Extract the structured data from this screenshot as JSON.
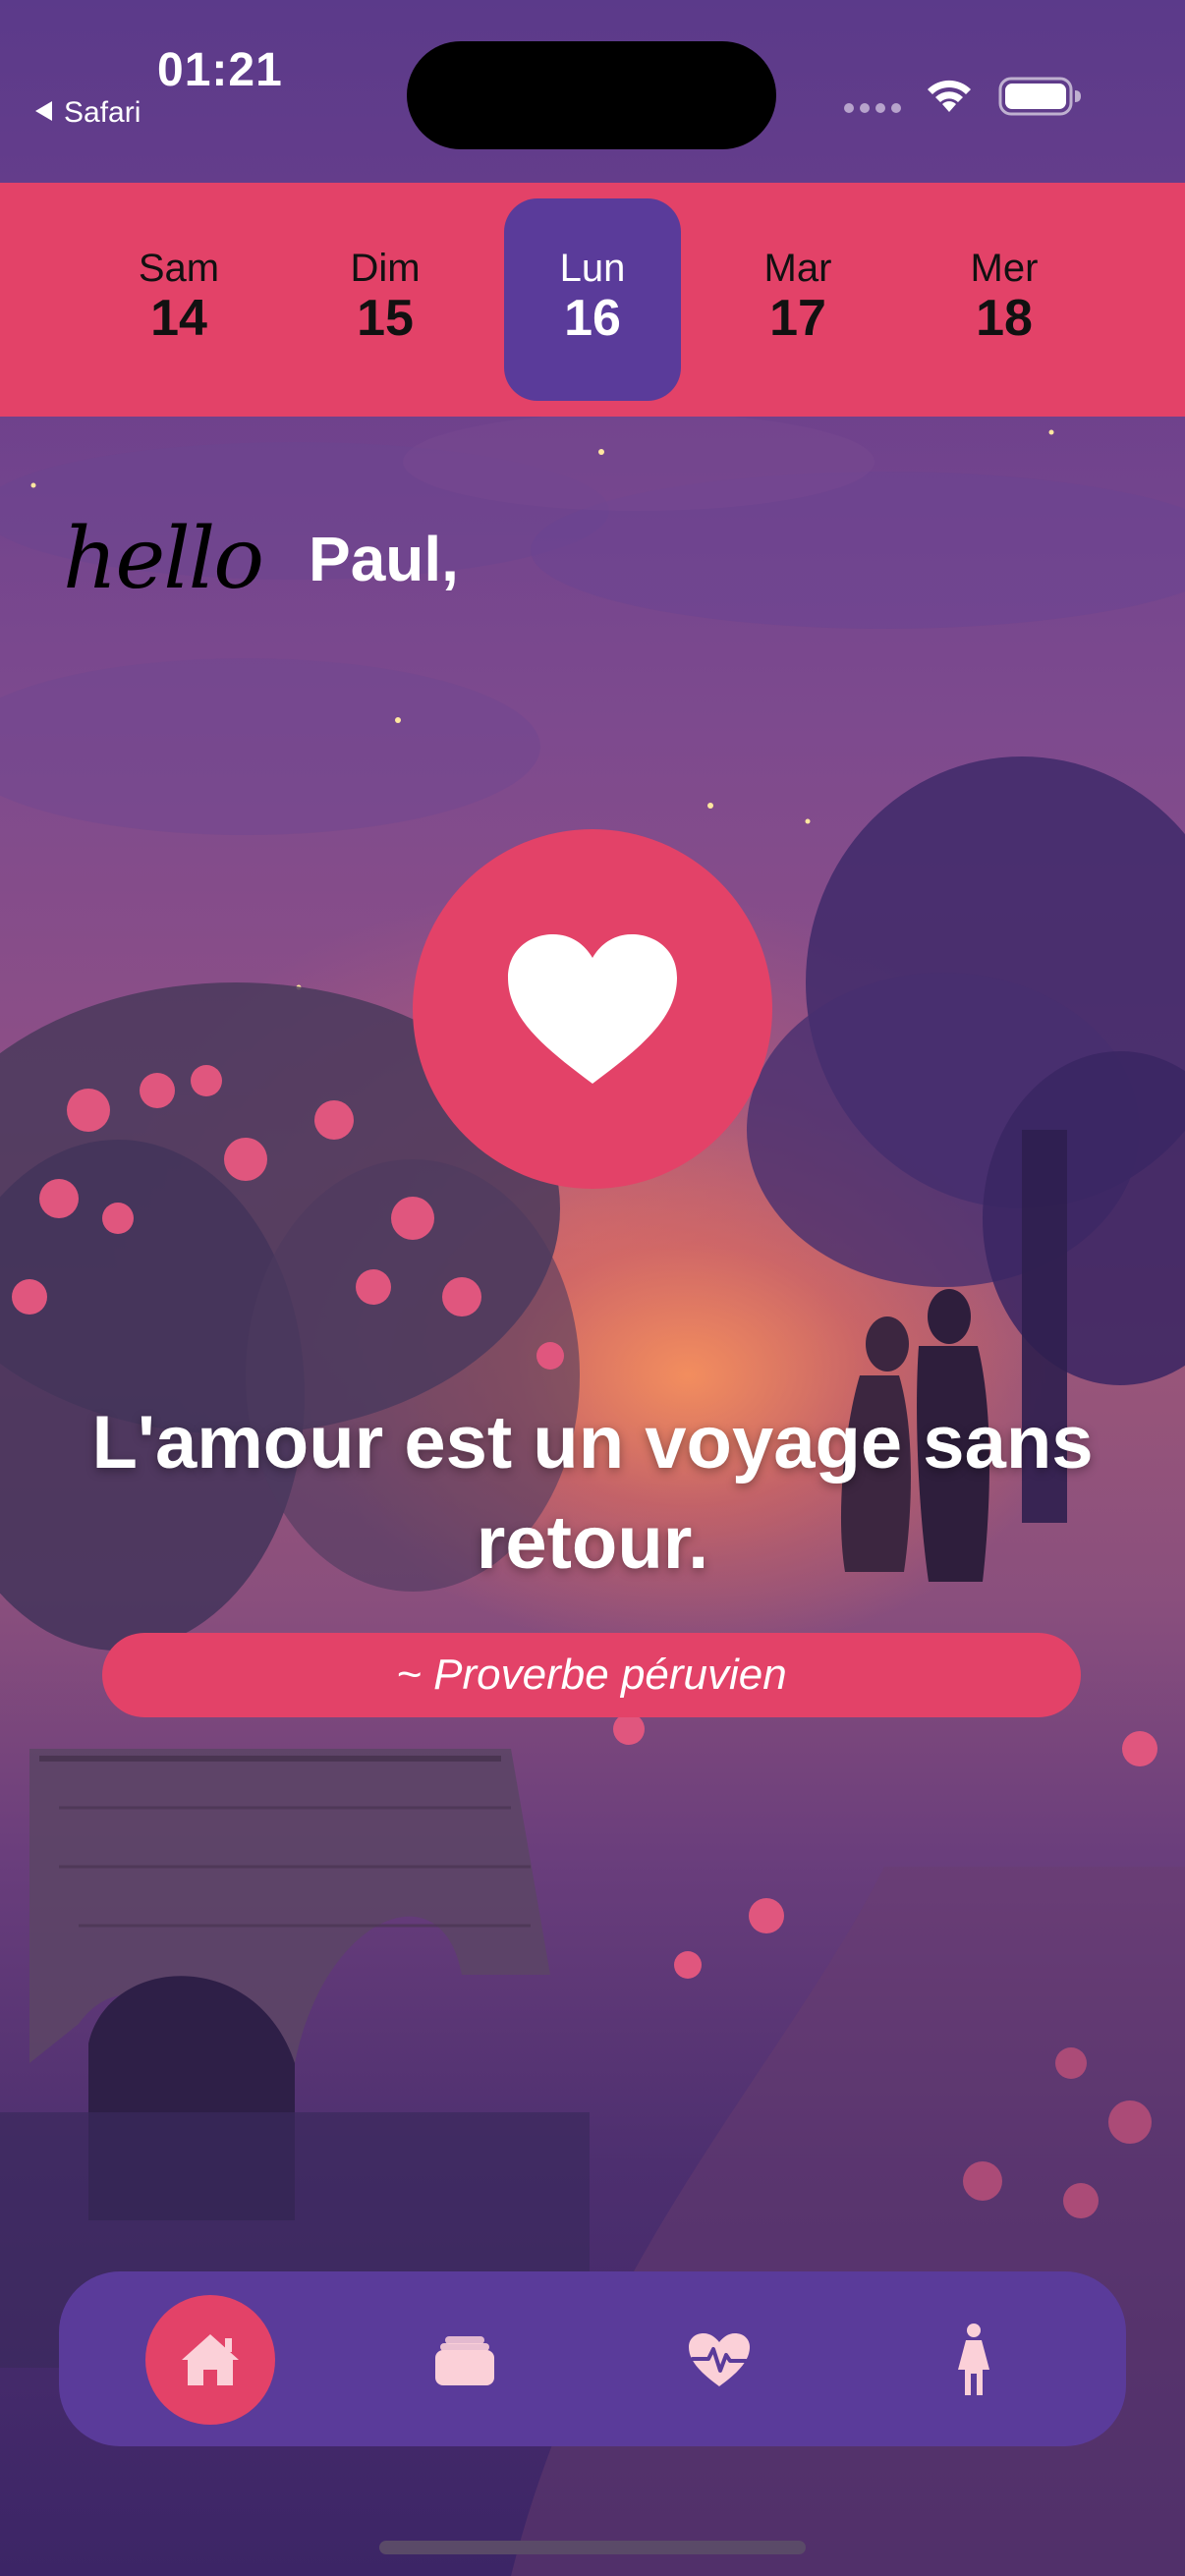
{
  "status_bar": {
    "time": "01:21",
    "back_app": "Safari"
  },
  "date_strip": {
    "days": [
      {
        "name": "Sam",
        "num": "14",
        "active": false
      },
      {
        "name": "Dim",
        "num": "15",
        "active": false
      },
      {
        "name": "Lun",
        "num": "16",
        "active": true
      },
      {
        "name": "Mar",
        "num": "17",
        "active": false
      },
      {
        "name": "Mer",
        "num": "18",
        "active": false
      }
    ]
  },
  "greeting": {
    "hello": "hello",
    "name": "Paul,"
  },
  "quote": {
    "text": "L'amour est un voyage sans retour.",
    "author": "~ Proverbe péruvien"
  },
  "tab_bar": {
    "tabs": [
      {
        "icon": "home-icon",
        "active": true
      },
      {
        "icon": "cards-stack-icon",
        "active": false
      },
      {
        "icon": "heart-pulse-icon",
        "active": false
      },
      {
        "icon": "woman-icon",
        "active": false
      }
    ]
  },
  "colors": {
    "accent_pink": "#e34268",
    "accent_purple": "#5a3b9a",
    "icon_light": "#fbd0d8"
  }
}
